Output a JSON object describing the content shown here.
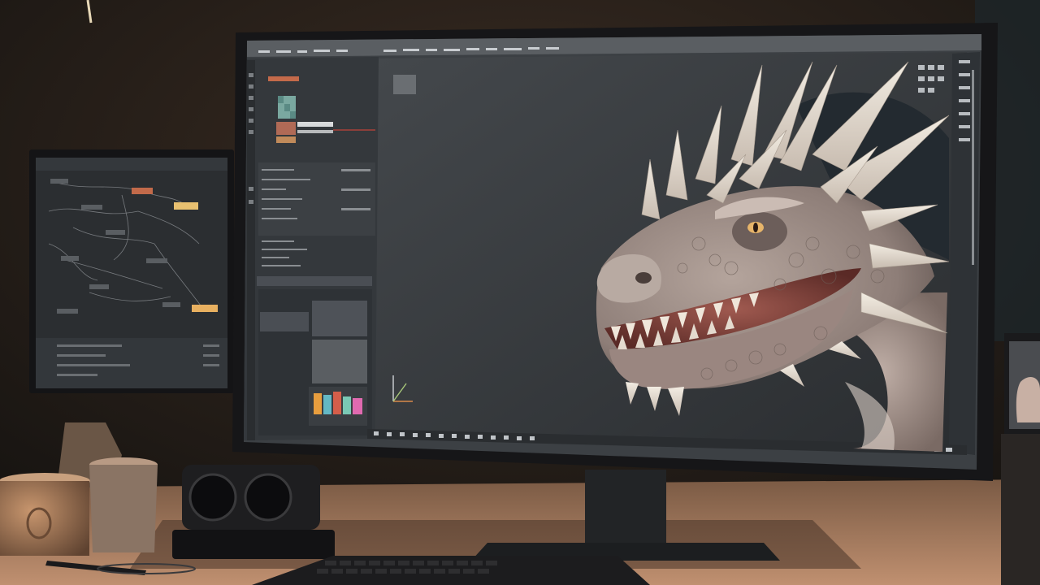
{
  "scene": {
    "description_type": "photo",
    "colors": {
      "wall": "#1c1a18",
      "wall_warm": "#3a2c22",
      "desk": "#b08566",
      "desk_shadow": "#5a4434",
      "monitor_bezel": "#1a1a1c",
      "app_background": "#3c4044",
      "viewport_background": "#3a3d40",
      "panel_dark": "#2c2f33",
      "panel_mid": "#4a4e54",
      "highlight_red": "#c0413a",
      "highlight_amber": "#e7b56a",
      "dragon_skin": "#9a8a84",
      "dragon_mouth": "#8c4a44",
      "dragon_horn": "#e8e0d4",
      "node_editor_bg": "#2b2e31"
    }
  },
  "main_monitor": {
    "application": "3d-sculpting-software",
    "menu_bar": {},
    "left_panel": {},
    "viewport": {
      "subject": "dragon-head-sculpture",
      "axis_gizmo": true
    },
    "right_toolbar": {},
    "timeline_bar": {}
  },
  "secondary_monitor": {
    "application": "node-graph-editor"
  }
}
